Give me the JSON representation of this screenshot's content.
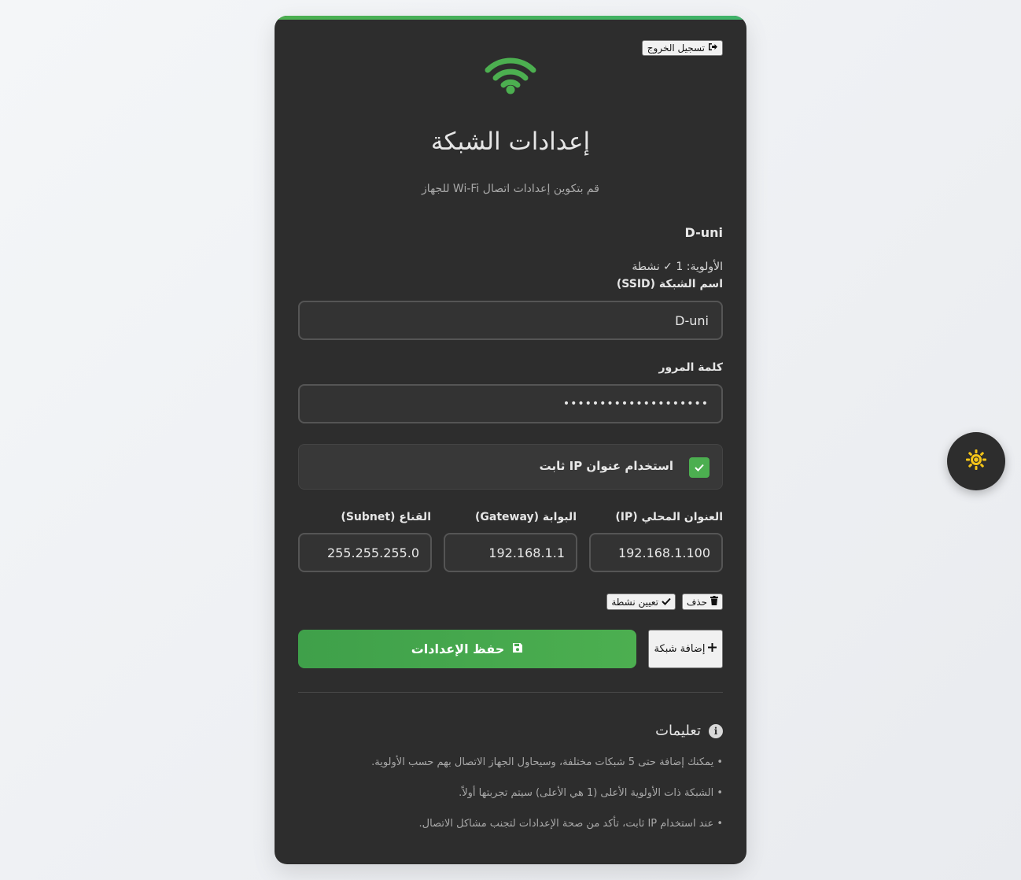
{
  "header": {
    "logout_label": "تسجيل الخروج",
    "title": "إعدادات الشبكة",
    "subtitle": "قم بتكوين إعدادات اتصال Wi-Fi للجهاز"
  },
  "network": {
    "name": "D-uni",
    "priority_text": "الأولوية: 1 ✓ نشطة",
    "ssid_label": "اسم الشبكة (SSID)",
    "ssid_value": "D-uni",
    "password_label": "كلمة المرور",
    "password_value": "••••••••••••••••••••",
    "static_ip_label": "استخدام عنوان IP ثابت",
    "static_ip_checked": true,
    "ip_label": "العنوان المحلي (IP)",
    "ip_value": "192.168.1.100",
    "gateway_label": "البوابة (Gateway)",
    "gateway_value": "192.168.1.1",
    "subnet_label": "القناع (Subnet)",
    "subnet_value": "255.255.255.0",
    "delete_label": "حذف",
    "set_active_label": "تعيين نشطة"
  },
  "actions": {
    "save_label": "حفظ الإعدادات",
    "add_network_label": "إضافة شبكة"
  },
  "instructions": {
    "title": "تعليمات",
    "items": [
      "• يمكنك إضافة حتى 5 شبكات مختلفة، وسيحاول الجهاز الاتصال بهم حسب الأولوية.",
      "• الشبكة ذات الأولوية الأعلى (1 هي الأعلى) سيتم تجربتها أولاً.",
      "• عند استخدام IP ثابت، تأكد من صحة الإعدادات لتجنب مشاكل الاتصال."
    ]
  },
  "colors": {
    "accent": "#4caf50",
    "card": "#2d2d2d",
    "sun": "#f5c518"
  },
  "icons": {
    "logout": "sign-out-icon",
    "wifi": "wifi-icon",
    "check": "check-icon",
    "trash": "trash-icon",
    "save": "floppy-disk-icon",
    "plus": "plus-icon",
    "info": "info-icon",
    "theme": "sun-icon"
  }
}
